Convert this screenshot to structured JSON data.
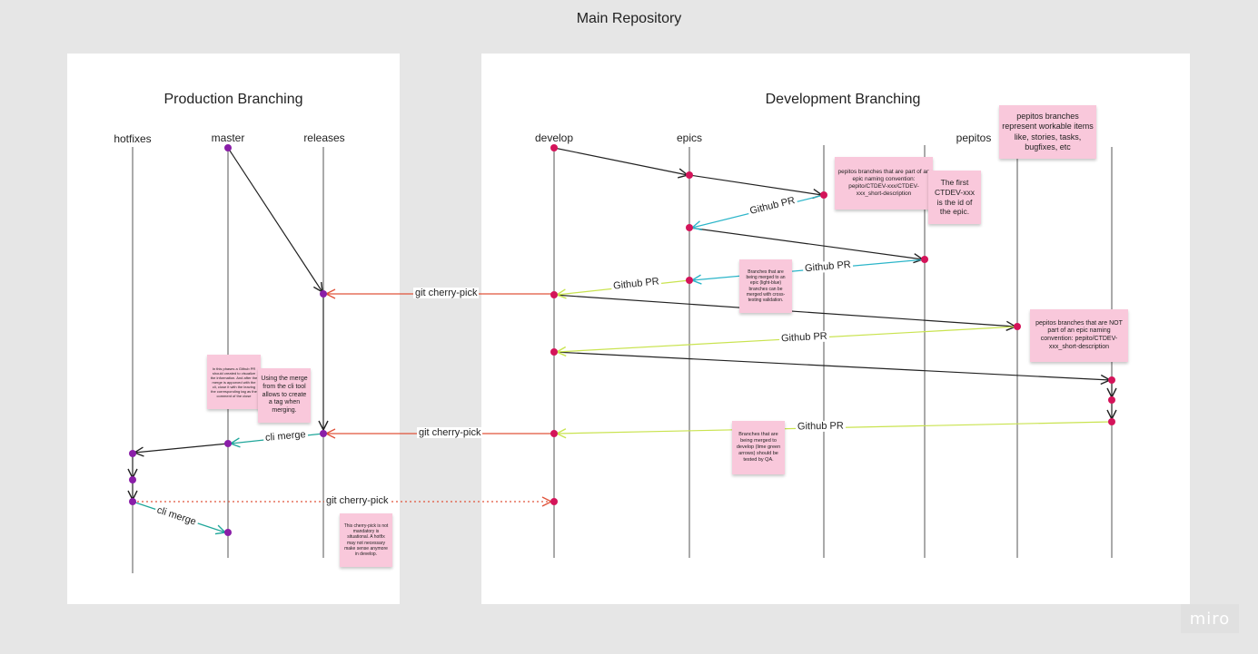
{
  "board": {
    "title": "Main Repository"
  },
  "production": {
    "title": "Production Branching",
    "lanes": {
      "hotfixes": "hotfixes",
      "master": "master",
      "releases": "releases"
    },
    "notes": {
      "github_pr_phase": "In this phases a Github PR should created to visualize the information. And after the merge is apporved with the cli, close it with the leaving the corresponding tag as the comment of the close",
      "cli_merge_tool": "Using the merge from the cli tool allows to create a tag when merging.",
      "cherry_pick_optional": "This cherry-pick is not mandatory is situational. A hotfix may not necessary make sense anymore in develop."
    }
  },
  "development": {
    "title": "Development Branching",
    "lanes": {
      "develop": "develop",
      "epics": "epics",
      "pepitos": "pepitos"
    },
    "notes": {
      "pepitos_workable": "pepitos branches represent workable items like, stories, tasks, bugfixes, etc",
      "epic_naming": "pepitos branches that are part of an epic naming convention: pepito/CTDEV-xxx/CTDEV-xxx_short-description",
      "first_ctdev": "The first CTDEV-xxx is the id of the epic.",
      "epic_cross_testing": "Branches that are being merged to an epic (light-blue) branches can be merged with cross-testing validation.",
      "not_epic_naming": "pepitos branches that are NOT part of an epic naming convention: pepito/CTDEV-xxx_short-description",
      "qa_testing": "Branches that are being merged to develop (lime green arrows) should be tested by QA."
    }
  },
  "arrows": {
    "cherry_pick_1": "git cherry-pick",
    "cherry_pick_2": "git cherry-pick",
    "cherry_pick_3": "git cherry-pick",
    "cli_merge_1": "cli merge",
    "cli_merge_2": "cli merge",
    "github_pr_1": "Github PR",
    "github_pr_2": "Github PR",
    "github_pr_3": "Github PR",
    "github_pr_4": "Github PR",
    "github_pr_5": "Github PR"
  },
  "colors": {
    "background": "#e6e6e6",
    "panel": "#ffffff",
    "note": "#f9c8db",
    "prod_node": "#8a1ea8",
    "dev_node": "#d4145a",
    "cherry_pick": "#e0533b",
    "epic_pr": "#2bb5c9",
    "develop_pr": "#c9e34f",
    "cli_merge": "#1fa69a",
    "neutral": "#222222"
  },
  "logo": "miro"
}
